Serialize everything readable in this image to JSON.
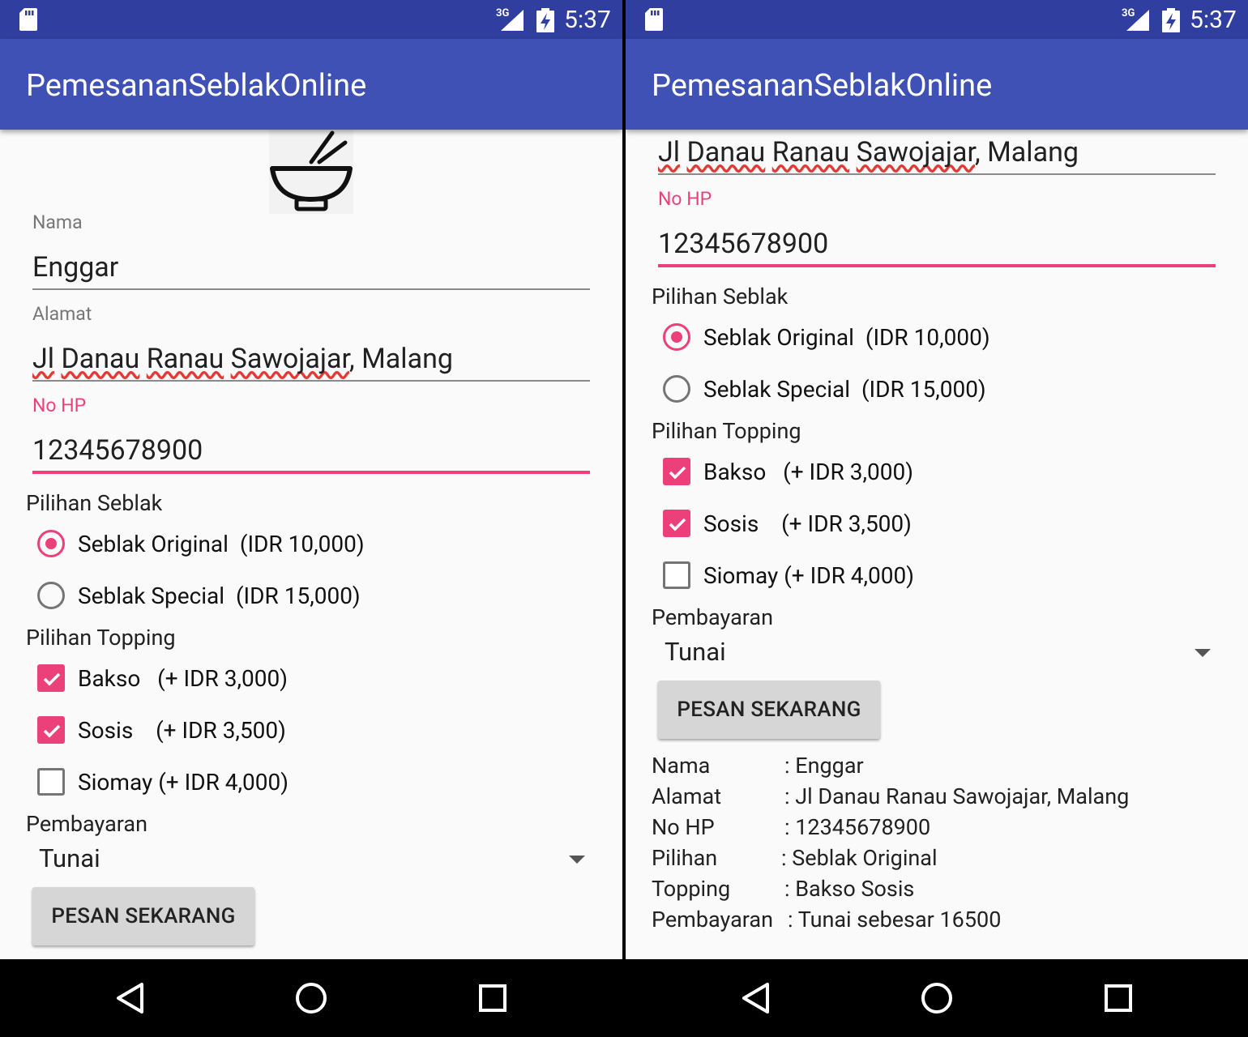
{
  "status_bar": {
    "network_label": "3G",
    "time": "5:37"
  },
  "app": {
    "title": "PemesananSeblakOnline"
  },
  "form": {
    "name_label": "Nama",
    "name_value": "Enggar",
    "address_label": "Alamat",
    "address_words": [
      "Jl",
      "Danau",
      "Ranau",
      "Sawojajar",
      ", Malang"
    ],
    "phone_label": "No HP",
    "phone_value": "12345678900",
    "seblak_label": "Pilihan Seblak",
    "seblak_options": [
      {
        "name": "Seblak Original",
        "price": "(IDR 10,000)",
        "selected": true
      },
      {
        "name": "Seblak Special",
        "price": "(IDR 15,000)",
        "selected": false
      }
    ],
    "topping_label": "Pilihan Topping",
    "topping_options": [
      {
        "name": "Bakso",
        "price": "(+ IDR 3,000)",
        "checked": true
      },
      {
        "name": "Sosis",
        "price": "(+ IDR 3,500)",
        "checked": true
      },
      {
        "name": "Siomay",
        "price": "(+ IDR 4,000)",
        "checked": false
      }
    ],
    "payment_label": "Pembayaran",
    "payment_value": "Tunai",
    "order_button": "PESAN SEKARANG"
  },
  "summary": {
    "rows": [
      {
        "key": "Nama",
        "value": ": Enggar"
      },
      {
        "key": "Alamat",
        "value": ": Jl Danau Ranau Sawojajar, Malang"
      },
      {
        "key": "No HP",
        "value": ": 12345678900"
      },
      {
        "key": "Pilihan",
        "value": ": Seblak Original"
      },
      {
        "key": "Topping",
        "value": ": Bakso Sosis"
      },
      {
        "key": "Pembayaran",
        "value": ": Tunai sebesar 16500"
      }
    ]
  },
  "icons": {
    "sd_card": "sd-card-icon",
    "signal": "signal-3g-icon",
    "battery": "battery-charging-icon",
    "logo": "bowl-chopsticks-icon",
    "back": "back-triangle-icon",
    "home": "home-circle-icon",
    "recents": "recents-square-icon"
  },
  "colors": {
    "status_bar": "#303f9f",
    "app_bar": "#3f51b5",
    "accent": "#ec407a",
    "background": "#fafafa"
  }
}
